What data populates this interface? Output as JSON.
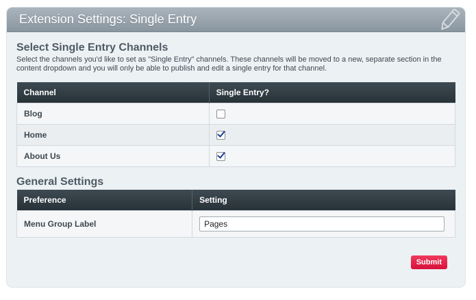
{
  "header": {
    "title": "Extension Settings: Single Entry",
    "icon": "pencil-icon"
  },
  "channels_section": {
    "title": "Select Single Entry Channels",
    "description": "Select the channels you'd like to set as \"Single Entry\" channels. These channels will be moved to a new, separate section in the content dropdown and you will only be able to publish and edit a single entry for that channel.",
    "columns": [
      "Channel",
      "Single Entry?"
    ],
    "rows": [
      {
        "channel": "Blog",
        "single_entry": false
      },
      {
        "channel": "Home",
        "single_entry": true
      },
      {
        "channel": "About Us",
        "single_entry": true
      }
    ]
  },
  "general_section": {
    "title": "General Settings",
    "columns": [
      "Preference",
      "Setting"
    ],
    "rows": [
      {
        "preference": "Menu Group Label",
        "value": "Pages"
      }
    ]
  },
  "submit_label": "Submit",
  "colors": {
    "header": "#9aa5ae",
    "table_header": "#2f3a41",
    "submit": "#e31b45"
  }
}
